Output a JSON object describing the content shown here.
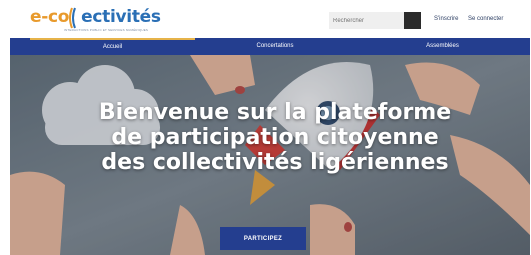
{
  "logo": {
    "part1": "e-co",
    "part2": "ectivités",
    "tagline": "INTERACTIONS PUBLIC ET SERVICES NUMÉRIQUES"
  },
  "search": {
    "placeholder": "Rechercher"
  },
  "account": {
    "signup": "S'inscrire",
    "login": "Se connecter"
  },
  "nav": {
    "items": [
      {
        "label": "Accueil",
        "active": true
      },
      {
        "label": "Concertations"
      },
      {
        "label": "Assemblées"
      }
    ]
  },
  "hero": {
    "title_lines": [
      "Bienvenue sur la plateforme",
      "de participation citoyenne",
      "des collectivités ligériennes"
    ],
    "cta": "PARTICIPEZ"
  },
  "colors": {
    "brand_blue": "#243e8f",
    "logo_orange": "#e89a2c",
    "logo_blue": "#2a6fb5",
    "active_underline": "#e6b34a"
  }
}
